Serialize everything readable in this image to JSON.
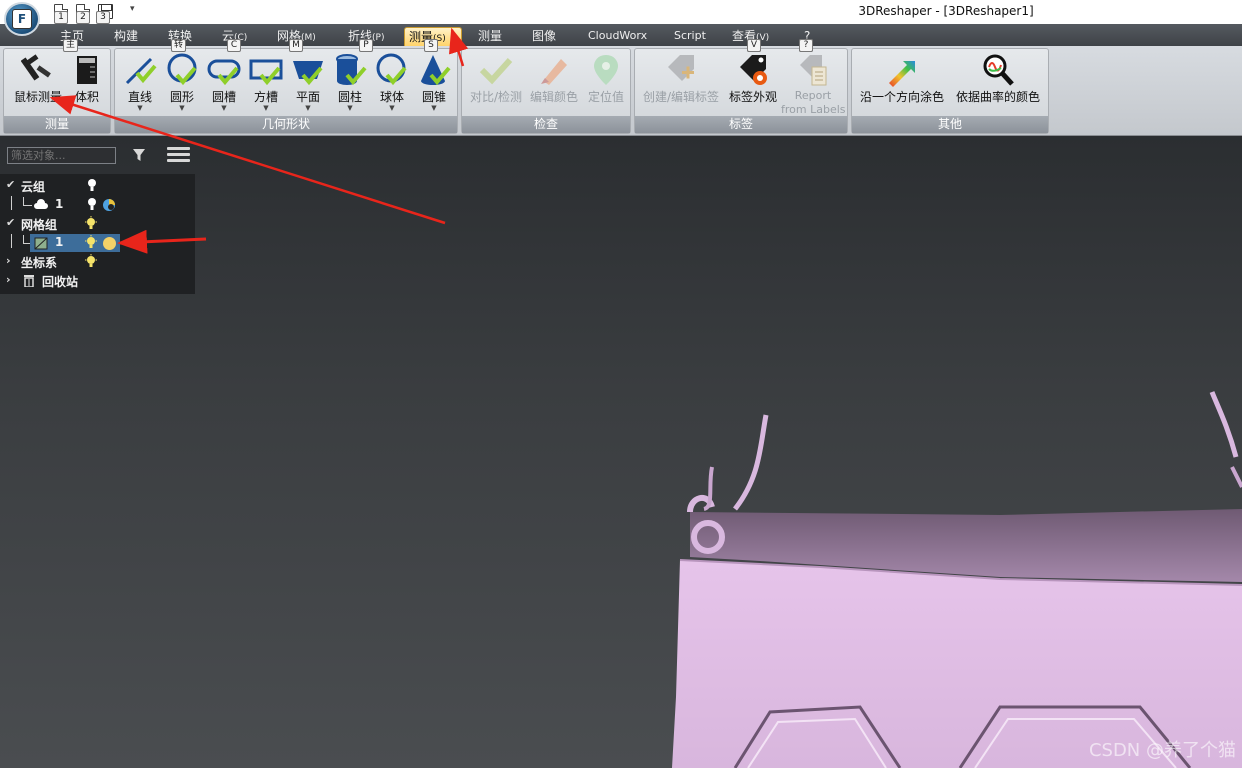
{
  "window": {
    "title": "3DReshaper - [3DReshaper1]"
  },
  "quick_access": {
    "keytips": [
      "1",
      "2",
      "3"
    ],
    "dropdown": "▾"
  },
  "tabs": [
    {
      "label": "主页",
      "keytip": "主"
    },
    {
      "label": "构建",
      "keytip": ""
    },
    {
      "label": "转换",
      "keytip": "转"
    },
    {
      "label": "云",
      "suffix": "(C)",
      "keytip": "C"
    },
    {
      "label": "网格",
      "suffix": "(M)",
      "keytip": "M"
    },
    {
      "label": "折线",
      "suffix": "(P)",
      "keytip": "P"
    },
    {
      "label": "测量",
      "suffix": "(S)",
      "keytip": "S",
      "active": true
    },
    {
      "label": "测量",
      "keytip": ""
    },
    {
      "label": "图像",
      "keytip": ""
    },
    {
      "label": "CloudWorx",
      "keytip": ""
    },
    {
      "label": "Script",
      "keytip": ""
    },
    {
      "label": "查看",
      "suffix": "(V)",
      "keytip": "V"
    },
    {
      "label": "?",
      "keytip": "?"
    }
  ],
  "ribbon": {
    "groups": [
      {
        "label": "测量",
        "buttons": [
          "鼠标测量",
          "体积"
        ]
      },
      {
        "label": "几何形状",
        "buttons": [
          "直线",
          "圆形",
          "圆槽",
          "方槽",
          "平面",
          "圆柱",
          "球体",
          "圆锥"
        ]
      },
      {
        "label": "检查",
        "buttons": [
          "对比/检测",
          "编辑颜色",
          "定位值"
        ]
      },
      {
        "label": "标签",
        "buttons": [
          "创建/编辑标签",
          "标签外观",
          "Report",
          "from Labels"
        ]
      },
      {
        "label": "其他",
        "buttons": [
          "沿一个方向涂色",
          "依据曲率的颜色"
        ]
      }
    ]
  },
  "tree_panel": {
    "filter_placeholder": "筛选对象...",
    "items": [
      {
        "label": "云组"
      },
      {
        "label": "1"
      },
      {
        "label": "网格组"
      },
      {
        "label": "1"
      },
      {
        "label": "坐标系"
      },
      {
        "label": "回收站"
      }
    ]
  },
  "watermark": "CSDN @养了个猫",
  "colors": {
    "mesh": "#d9b8df",
    "accent_arrow": "#e8251b",
    "active_tab": "#ffd36a",
    "selection": "#3d6d9a"
  }
}
